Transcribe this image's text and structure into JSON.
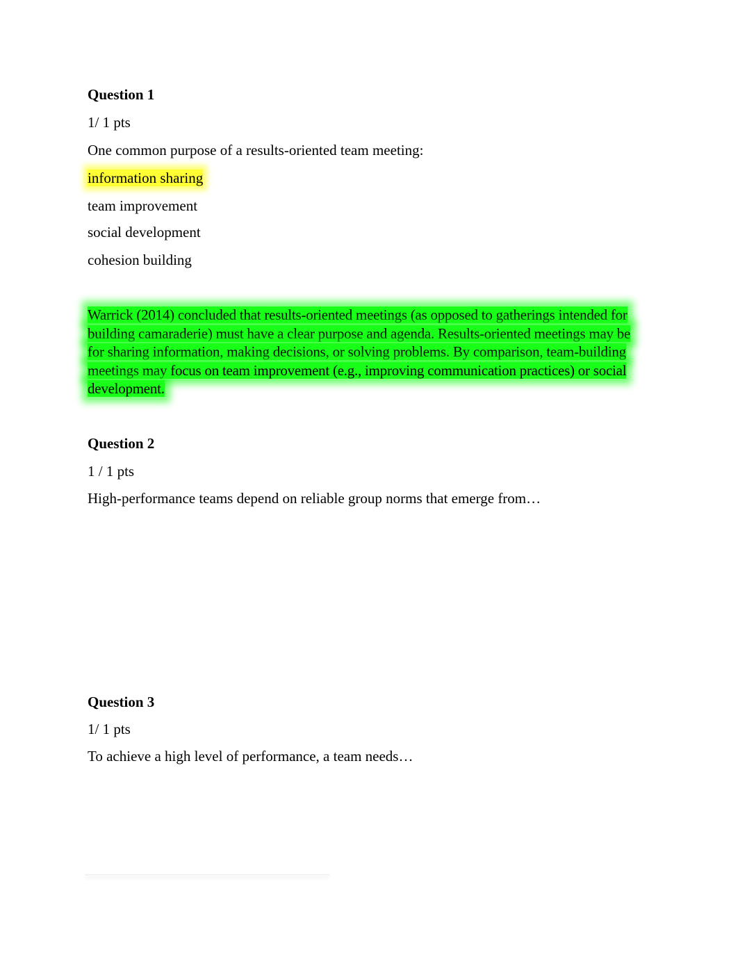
{
  "questions": [
    {
      "title": "Question 1",
      "points": "1/ 1 pts",
      "prompt": "One common purpose of a results-oriented team meeting:",
      "options": [
        "information sharing",
        "team improvement",
        "social development",
        "cohesion building"
      ],
      "selected_option": "information sharing",
      "explanation": "Warrick (2014) concluded that results-oriented meetings (as opposed to gatherings intended for building camaraderie) must have a clear purpose and agenda. Results-oriented meetings may be for sharing information, making decisions, or solving problems. By comparison, team-building meetings may focus on team improvement (e.g., improving communication practices) or social development."
    },
    {
      "title": "Question 2",
      "points": "1 / 1 pts",
      "prompt": "High-performance teams depend on reliable group norms that emerge from…"
    },
    {
      "title": "Question 3",
      "points": "1/ 1 pts",
      "prompt": "To achieve a high level of performance, a team needs…"
    }
  ],
  "colors": {
    "selected_highlight": "#ffff33",
    "explanation_highlight": "#19ff19"
  }
}
